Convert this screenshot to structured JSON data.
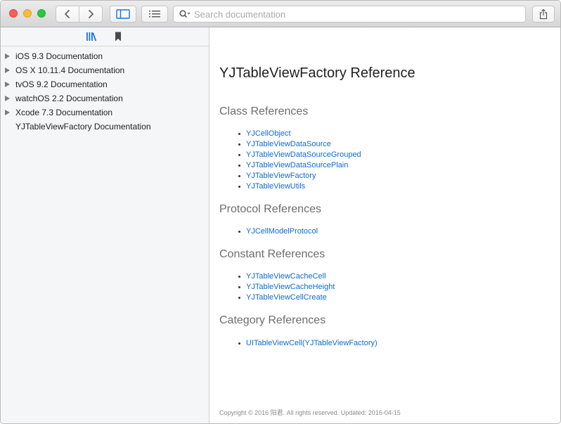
{
  "toolbar": {
    "search_placeholder": "Search documentation"
  },
  "sidebar": {
    "items": [
      {
        "label": "iOS 9.3 Documentation",
        "expandable": true
      },
      {
        "label": "OS X 10.11.4 Documentation",
        "expandable": true
      },
      {
        "label": "tvOS 9.2 Documentation",
        "expandable": true
      },
      {
        "label": "watchOS 2.2 Documentation",
        "expandable": true
      },
      {
        "label": "Xcode 7.3 Documentation",
        "expandable": true
      },
      {
        "label": "YJTableViewFactory Documentation",
        "expandable": false
      }
    ]
  },
  "main": {
    "title": "YJTableViewFactory Reference",
    "sections": [
      {
        "heading": "Class References",
        "links": [
          "YJCellObject",
          "YJTableViewDataSource",
          "YJTableViewDataSourceGrouped",
          "YJTableViewDataSourcePlain",
          "YJTableViewFactory",
          "YJTableViewUtils"
        ]
      },
      {
        "heading": "Protocol References",
        "links": [
          "YJCellModelProtocol"
        ]
      },
      {
        "heading": "Constant References",
        "links": [
          "YJTableViewCacheCell",
          "YJTableViewCacheHeight",
          "YJTableViewCellCreate"
        ]
      },
      {
        "heading": "Category References",
        "links": [
          "UITableViewCell(YJTableViewFactory)"
        ]
      }
    ],
    "footer": "Copyright © 2016 阳君. All rights reserved. Updated: 2016-04-15"
  },
  "colors": {
    "link": "#0e6bd1",
    "accent": "#1a74d9"
  }
}
